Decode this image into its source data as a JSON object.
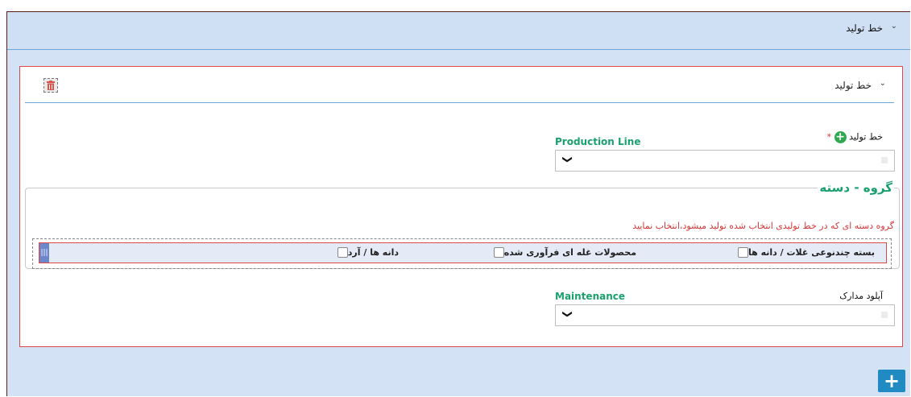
{
  "top_section": {
    "title": "خط تولید",
    "chevron": "chevron-down-icon"
  },
  "panel": {
    "title": "خط تولید",
    "delete_icon": "trash-icon",
    "production_field": {
      "label_fa": "خط تولید",
      "required_mark": "*",
      "label_en": "Production Line",
      "selected_value": ""
    },
    "group": {
      "legend": "گروه - دسته",
      "hint": "گروه دسته ای که در خط تولیدی انتخاب شده تولید میشود،انتخاب نمایید",
      "options": [
        {
          "label": "بسته چندنوعی غلات / دانه ها",
          "checked": false
        },
        {
          "label": "محصولات غله ای فرآوری شده",
          "checked": false
        },
        {
          "label": "دانه ها / آرد",
          "checked": false
        }
      ]
    },
    "upload_field": {
      "label_fa": "آپلود مدارک",
      "label_en": "Maintenance",
      "selected_value": ""
    }
  },
  "add_button_label": "+"
}
